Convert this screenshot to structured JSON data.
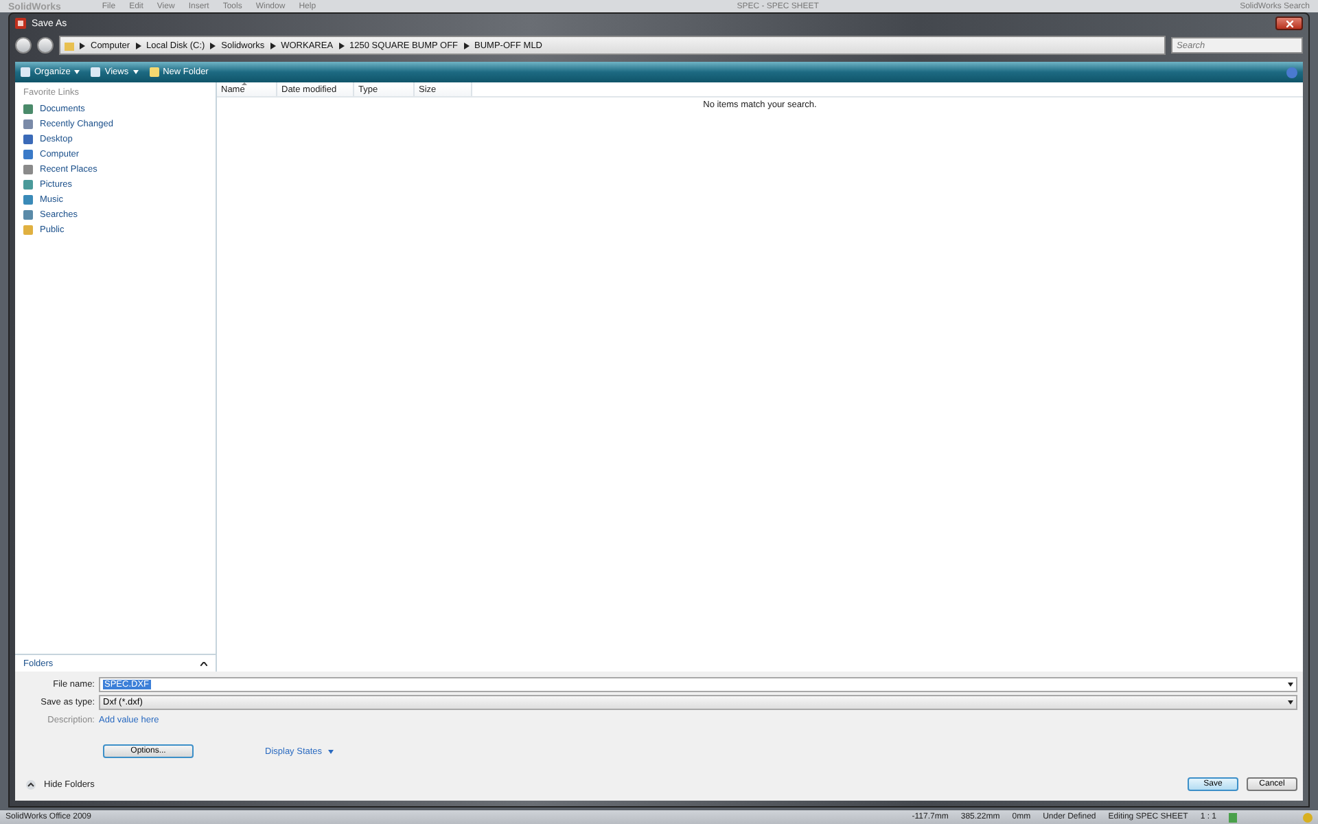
{
  "app": {
    "brand": "SolidWorks",
    "menus": [
      "File",
      "Edit",
      "View",
      "Insert",
      "Tools",
      "Window",
      "Help"
    ],
    "document_title": "SPEC - SPEC SHEET",
    "search_label": "SolidWorks Search"
  },
  "dialog": {
    "title": "Save As",
    "breadcrumbs": [
      "Computer",
      "Local Disk (C:)",
      "Solidworks",
      "WORKAREA",
      "1250 SQUARE BUMP OFF",
      "BUMP-OFF MLD"
    ],
    "search": {
      "placeholder": "Search"
    },
    "toolbar": [
      {
        "label": "Organize",
        "kind": "menu"
      },
      {
        "label": "Views",
        "kind": "menu"
      },
      {
        "label": "New Folder",
        "kind": "button"
      }
    ],
    "favorites": {
      "heading": "Favorite Links",
      "items": [
        {
          "label": "Documents"
        },
        {
          "label": "Recently Changed"
        },
        {
          "label": "Desktop"
        },
        {
          "label": "Computer"
        },
        {
          "label": "Recent Places"
        },
        {
          "label": "Pictures"
        },
        {
          "label": "Music"
        },
        {
          "label": "Searches"
        },
        {
          "label": "Public"
        }
      ]
    },
    "folders_label": "Folders",
    "columns": [
      {
        "label": "Name",
        "sorted": true
      },
      {
        "label": "Date modified",
        "sorted": false
      },
      {
        "label": "Type",
        "sorted": false
      },
      {
        "label": "Size",
        "sorted": false
      }
    ],
    "empty_message": "No items match your search.",
    "file_name": {
      "label": "File name:",
      "value": "SPEC.DXF"
    },
    "save_type": {
      "label": "Save as type:",
      "value": "Dxf (*.dxf)"
    },
    "description": {
      "label": "Description:",
      "link": "Add value here"
    },
    "options_button": "Options...",
    "display_states": "Display States",
    "hide_folders": "Hide Folders",
    "buttons": [
      {
        "label": "Save",
        "default": true
      },
      {
        "label": "Cancel",
        "default": false
      }
    ]
  },
  "status_bar": {
    "product": "SolidWorks Office 2009",
    "items": [
      "-117.7mm",
      "385.22mm",
      "0mm",
      "Under Defined",
      "Editing SPEC SHEET",
      "1 : 1"
    ]
  }
}
